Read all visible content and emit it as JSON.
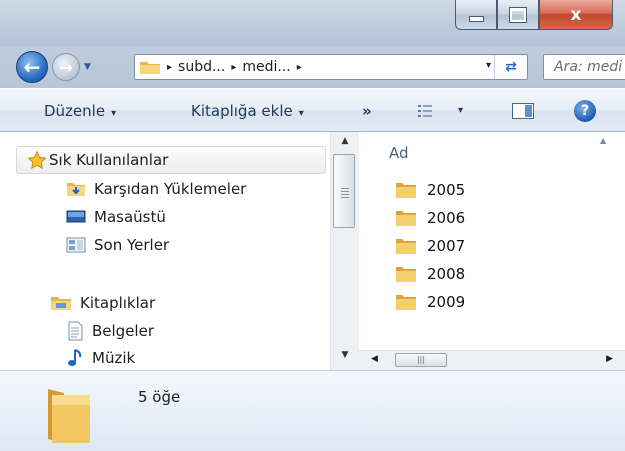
{
  "window": {
    "caption_buttons": {
      "minimize_icon": "minimize-icon",
      "maximize_icon": "maximize-icon",
      "close_glyph": "x"
    }
  },
  "navigation": {
    "back_icon": "back-arrow-icon",
    "forward_icon": "forward-arrow-icon",
    "address": {
      "breadcrumbs": [
        "subd...",
        "medi..."
      ],
      "separator": "▸",
      "dropdown": "▾",
      "refresh_icon": "refresh-icon"
    },
    "search": {
      "placeholder": "Ara: medi"
    }
  },
  "command_bar": {
    "organize_label": "Düzenle",
    "add_to_library_label": "Kitaplığa ekle",
    "more_label": "»",
    "dropdown_glyph": "▾",
    "views_icon": "views-icon",
    "preview_pane_icon": "preview-pane-icon",
    "help_glyph": "?"
  },
  "nav_pane": {
    "favorites": {
      "label": "Sık Kullanılanlar",
      "icon": "star-icon",
      "items": [
        {
          "label": "Karşıdan Yüklemeler",
          "icon": "downloads-folder-icon"
        },
        {
          "label": "Masaüstü",
          "icon": "desktop-icon"
        },
        {
          "label": "Son Yerler",
          "icon": "recent-places-icon"
        }
      ]
    },
    "libraries": {
      "label": "Kitaplıklar",
      "icon": "libraries-icon",
      "items": [
        {
          "label": "Belgeler",
          "icon": "documents-icon"
        },
        {
          "label": "Müzik",
          "icon": "music-icon"
        }
      ]
    }
  },
  "content": {
    "column_header": "Ad",
    "files": [
      {
        "name": "2005",
        "icon": "folder-icon"
      },
      {
        "name": "2006",
        "icon": "folder-icon"
      },
      {
        "name": "2007",
        "icon": "folder-icon"
      },
      {
        "name": "2008",
        "icon": "folder-icon"
      },
      {
        "name": "2009",
        "icon": "folder-icon"
      }
    ]
  },
  "details": {
    "item_count": "5 öğe"
  },
  "colors": {
    "accent": "#2a6fc2",
    "close": "#c1452c",
    "folder": "#f0c35a"
  }
}
